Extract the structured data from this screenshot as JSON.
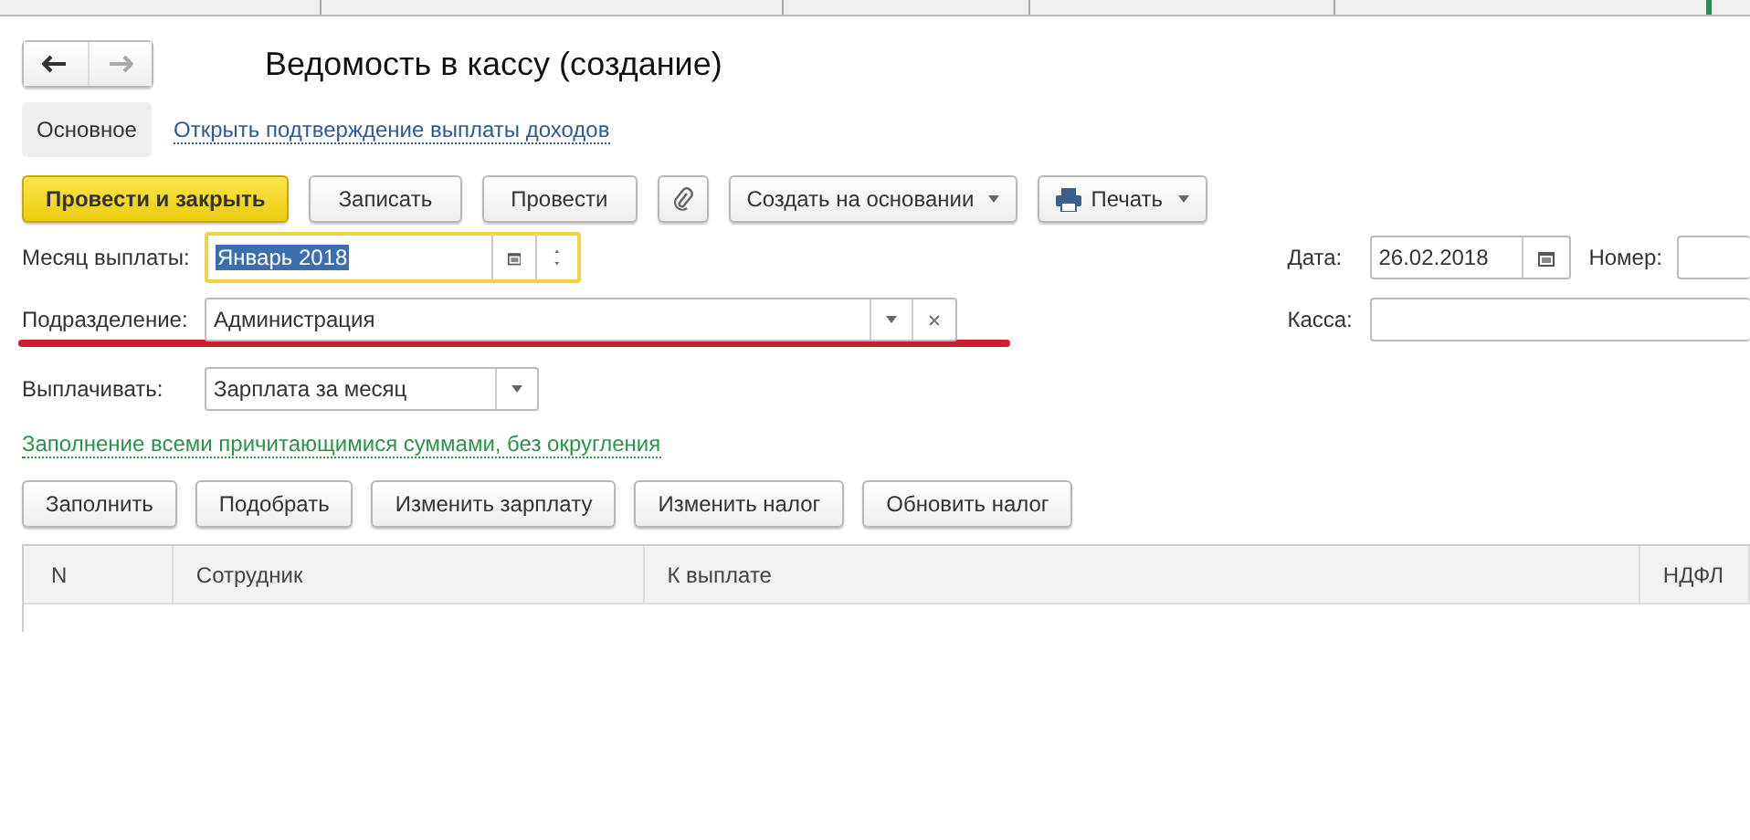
{
  "window": {
    "title": "Ведомость в кассу (создание)"
  },
  "nav": {
    "back_enabled": true,
    "forward_enabled": false
  },
  "tabs": [
    {
      "label": "Основное",
      "selected": true,
      "kind": "tab"
    },
    {
      "label": "Открыть подтверждение выплаты доходов",
      "selected": false,
      "kind": "link"
    }
  ],
  "toolbar": [
    {
      "label": "Провести и закрыть",
      "kind": "primary"
    },
    {
      "label": "Записать",
      "kind": "button"
    },
    {
      "label": "Провести",
      "kind": "button"
    },
    {
      "kind": "attach"
    },
    {
      "label": "Создать на основании",
      "kind": "menu"
    },
    {
      "label": "Печать",
      "kind": "print"
    }
  ],
  "month": {
    "label": "Месяц выплаты:",
    "value": "Январь 2018",
    "focused": true,
    "highlighted": true
  },
  "department": {
    "label": "Подразделение:",
    "value": "Администрация",
    "underlined": true
  },
  "pay": {
    "label": "Выплачивать:",
    "value": "Зарплата за месяц"
  },
  "date": {
    "label": "Дата:",
    "value": "26.02.2018"
  },
  "number": {
    "label": "Номер:"
  },
  "cash": {
    "label": "Касса:"
  },
  "fill_link": "Заполнение всеми причитающимися суммами, без округления",
  "table_buttons": [
    "Заполнить",
    "Подобрать",
    "Изменить зарплату",
    "Изменить налог",
    "Обновить налог"
  ],
  "table": {
    "columns": [
      "N",
      "Сотрудник",
      "К выплате",
      "НДФЛ"
    ]
  }
}
